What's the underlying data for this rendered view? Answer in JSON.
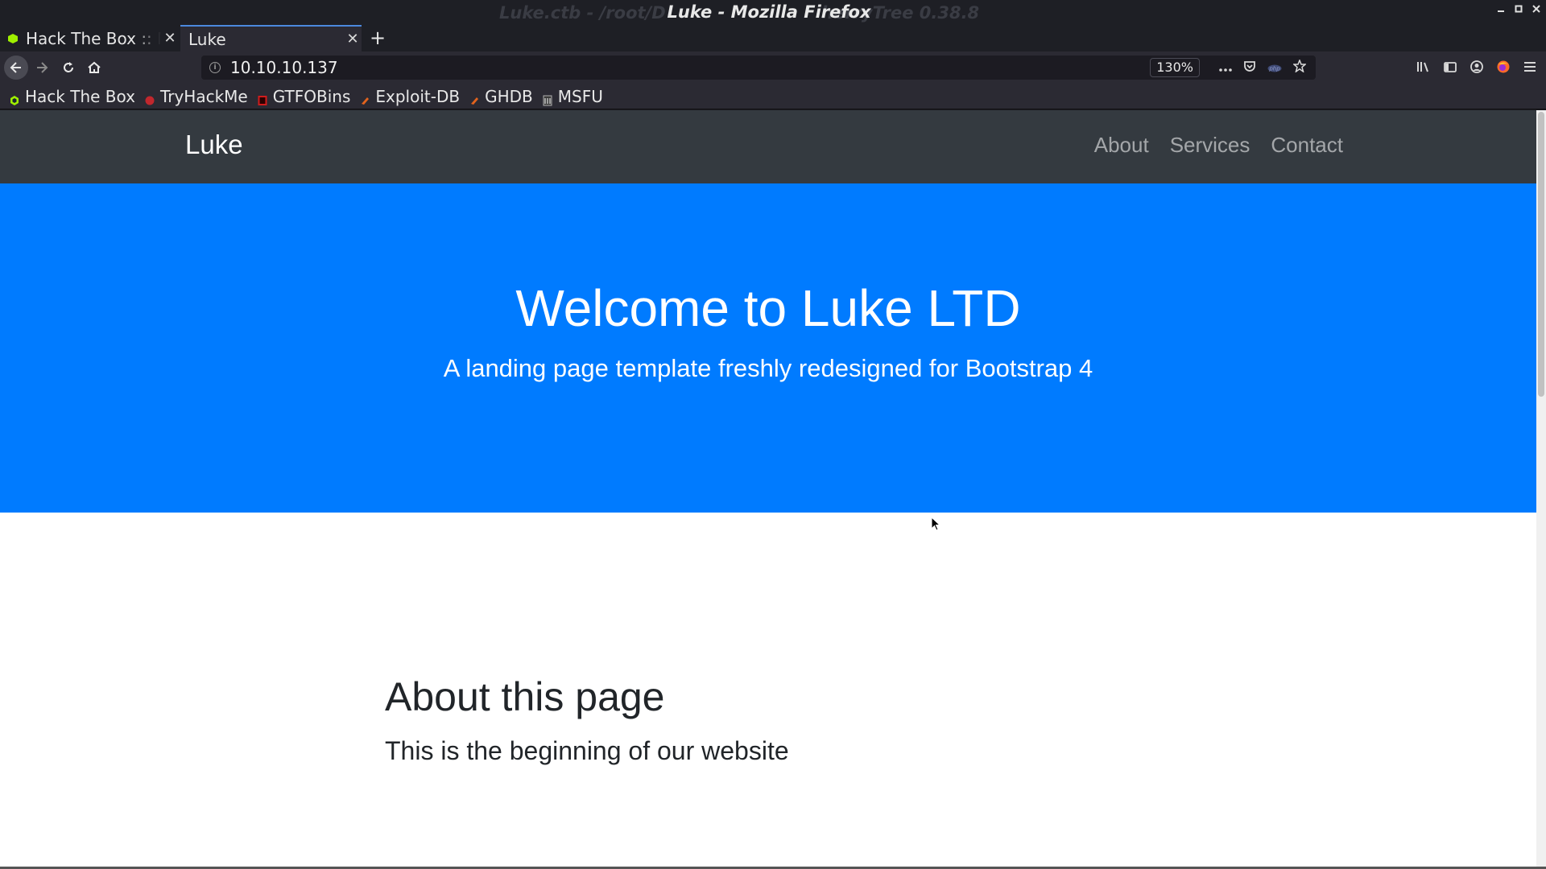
{
  "window": {
    "title": "Luke - Mozilla Firefox",
    "background_title_left": "Luke.ctb - /root/D",
    "background_title_right": "herryTree 0.38.8"
  },
  "tabs": [
    {
      "label": "Hack The Box :: My",
      "active": false
    },
    {
      "label": "Luke",
      "active": true
    }
  ],
  "toolbar": {
    "url": "10.10.10.137",
    "zoom": "130%"
  },
  "bookmarks": [
    {
      "label": "Hack The Box",
      "icon": "htb-icon",
      "color": "#9fef00"
    },
    {
      "label": "TryHackMe",
      "icon": "thm-icon",
      "color": "#c1272d"
    },
    {
      "label": "GTFOBins",
      "icon": "gtfobins-icon",
      "color": "#d01c1c"
    },
    {
      "label": "Exploit-DB",
      "icon": "exploitdb-icon",
      "color": "#e2631d"
    },
    {
      "label": "GHDB",
      "icon": "ghdb-icon",
      "color": "#e2631d"
    },
    {
      "label": "MSFU",
      "icon": "msfu-icon",
      "color": "#b0b0b0"
    }
  ],
  "site": {
    "brand": "Luke",
    "nav": [
      "About",
      "Services",
      "Contact"
    ],
    "hero_title": "Welcome to Luke LTD",
    "hero_subtitle": "A landing page template freshly redesigned for Bootstrap 4",
    "about_heading": "About this page",
    "about_text": "This is the beginning of our website",
    "colors": {
      "navbar": "#343a40",
      "hero": "#007bff"
    }
  }
}
